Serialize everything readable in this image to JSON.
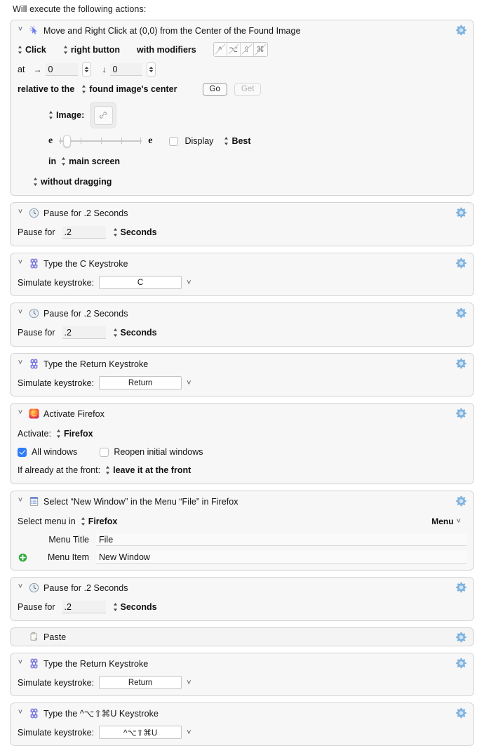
{
  "intro": "Will execute the following actions:",
  "actions": [
    {
      "id": "move-right-click",
      "icon": "cursor-click-icon",
      "title": "Move and Right Click at (0,0) from the Center of the Found Image",
      "click_popup": "Click",
      "button_popup": "right button",
      "modifiers_label": "with modifiers",
      "modifier_keys": [
        "^",
        "⌥",
        "⇧",
        "⌘"
      ],
      "at_label": "at",
      "x_value": "0",
      "y_value": "0",
      "relative_label": "relative to the",
      "relative_popup": "found image's center",
      "go_button": "Go",
      "get_button": "Get",
      "image_popup": "Image:",
      "image_icon": "link-icon",
      "fuzz_left": "e",
      "fuzz_right": "e",
      "display_label": "Display",
      "display_checked": false,
      "quality_popup": "Best",
      "in_label": "in",
      "screen_popup": "main screen",
      "drag_popup": "without dragging"
    },
    {
      "id": "pause-1",
      "icon": "clock-icon",
      "title": "Pause for .2 Seconds",
      "pause_label": "Pause for",
      "pause_value": ".2",
      "unit_popup": "Seconds"
    },
    {
      "id": "type-c",
      "icon": "command-key-icon",
      "title": "Type the C Keystroke",
      "sim_label": "Simulate keystroke:",
      "keystroke": "C"
    },
    {
      "id": "pause-2",
      "icon": "clock-icon",
      "title": "Pause for .2 Seconds",
      "pause_label": "Pause for",
      "pause_value": ".2",
      "unit_popup": "Seconds"
    },
    {
      "id": "type-return-1",
      "icon": "command-key-icon",
      "title": "Type the Return Keystroke",
      "sim_label": "Simulate keystroke:",
      "keystroke": "Return"
    },
    {
      "id": "activate-firefox",
      "icon": "firefox-icon",
      "title": "Activate Firefox",
      "activate_label": "Activate:",
      "activate_popup": "Firefox",
      "all_windows_label": "All windows",
      "all_windows_checked": true,
      "reopen_label": "Reopen initial windows",
      "reopen_checked": false,
      "front_label": "If already at the front:",
      "front_popup": "leave it at the front"
    },
    {
      "id": "select-menu",
      "icon": "menu-list-icon",
      "title": "Select “New Window” in the Menu “File” in Firefox",
      "select_label": "Select menu in",
      "app_popup": "Firefox",
      "menu_dropdown": "Menu",
      "menu_title_label": "Menu Title",
      "menu_title_value": "File",
      "menu_item_label": "Menu Item",
      "menu_item_value": "New Window",
      "add_icon": "plus-circle-icon"
    },
    {
      "id": "pause-3",
      "icon": "clock-icon",
      "title": "Pause for .2 Seconds",
      "pause_label": "Pause for",
      "pause_value": ".2",
      "unit_popup": "Seconds"
    },
    {
      "id": "paste",
      "icon": "clipboard-paste-icon",
      "title": "Paste"
    },
    {
      "id": "type-return-2",
      "icon": "command-key-icon",
      "title": "Type the Return Keystroke",
      "sim_label": "Simulate keystroke:",
      "keystroke": "Return"
    },
    {
      "id": "type-hyper-u",
      "icon": "command-key-icon",
      "title": "Type the ^⌥⇧⌘U Keystroke",
      "sim_label": "Simulate keystroke:",
      "keystroke": "^⌥⇧⌘U"
    }
  ],
  "colors": {
    "gear": "#7fb2dd",
    "checkbox_on": "#2f7cf6",
    "panel_bg": "#f7f7f7",
    "panel_border": "#d4d4d4",
    "accent_icon": "#8e8ee8"
  }
}
